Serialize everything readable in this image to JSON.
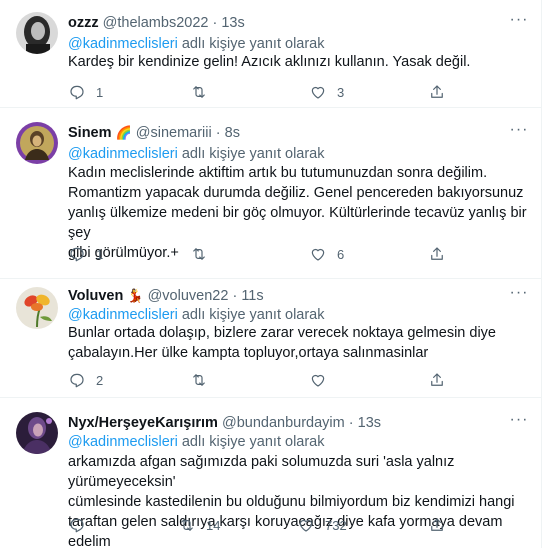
{
  "tweets": [
    {
      "name": "ozzz",
      "name_emoji": "",
      "handle": "@thelambs2022",
      "separator": "·",
      "time": "13s",
      "reply_prefix": "@kadinmeclisleri",
      "reply_suffix": "adlı kişiye yanıt olarak",
      "text": "Kardeş bir kendinize gelin!  Azıcık aklınızı kullanın. Yasak değil.",
      "replies": "1",
      "retweets": "",
      "likes": "3"
    },
    {
      "name": "Sinem",
      "name_emoji": "🌈",
      "handle": "@sinemariii",
      "separator": "·",
      "time": "8s",
      "reply_prefix": "@kadinmeclisleri",
      "reply_suffix": "adlı kişiye yanıt olarak",
      "text": "Kadın meclislerinde aktiftim artık bu tutumunuzdan sonra değilim.\nRomantizm yapacak durumda değiliz. Genel pencereden bakıyorsunuz\nyanlış ülkemize medeni bir göç olmuyor. Kültürlerinde tecavüz yanlış bir şey\ngibi görülmüyor.+",
      "replies": "1",
      "retweets": "",
      "likes": "6"
    },
    {
      "name": "Voluven",
      "name_emoji": "💃",
      "handle": "@voluven22",
      "separator": "·",
      "time": "11s",
      "reply_prefix": "@kadinmeclisleri",
      "reply_suffix": "adlı kişiye yanıt olarak",
      "text": "Bunlar ortada dolaşıp, bizlere zarar verecek noktaya gelmesin diye\nçabalayın.Her ülke kampta topluyor,ortaya salınmasinlar",
      "replies": "2",
      "retweets": "",
      "likes": ""
    },
    {
      "name": "Nyx/HerşeyeKarışırım",
      "name_emoji": "",
      "handle": "@bundanburdayim",
      "separator": "·",
      "time": "13s",
      "reply_prefix": "@kadinmeclisleri",
      "reply_suffix": "adlı kişiye yanıt olarak",
      "text": "arkamızda afgan sağımızda paki solumuzda suri 'asla yalnız yürümeyeceksin'\ncümlesinde kastedilenin bu olduğunu bilmiyordum  biz kendimizi hangi\ntaraftan gelen saldırıya karşı koruyacağız diye kafa yormaya devam edelim",
      "replies": "",
      "retweets": "14",
      "likes": "732"
    }
  ],
  "icons": {
    "reply": "reply-icon",
    "retweet": "retweet-icon",
    "like": "heart-icon",
    "share": "share-icon",
    "more": "more-icon"
  },
  "colors": {
    "accent": "#1d9bf0",
    "secondary_text": "#536471",
    "primary_text": "#0f1419",
    "divider": "#eff3f4"
  }
}
